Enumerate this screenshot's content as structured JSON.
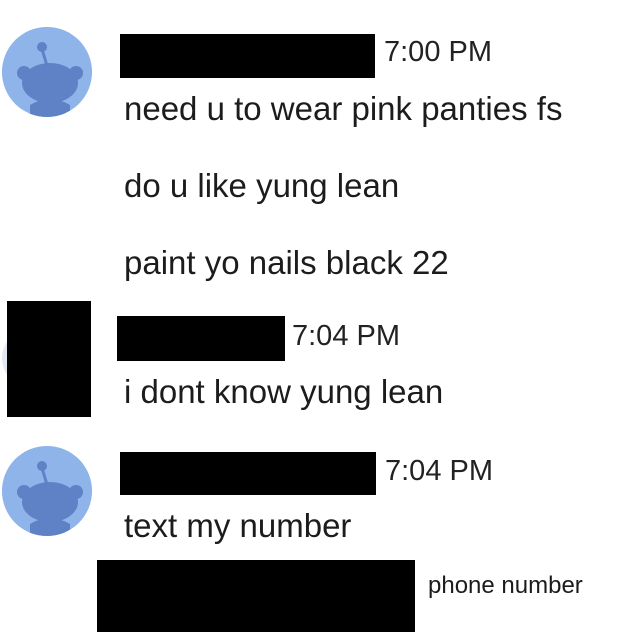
{
  "colors": {
    "avatar_bg": "#8fb4ea",
    "avatar_figure": "#5f81c6",
    "redaction": "#000000",
    "text": "#1c1c1c"
  },
  "groups": [
    {
      "avatar_icon": "reddit-snoo-icon",
      "timestamp": "7:00 PM",
      "messages": [
        "need u to wear pink panties fs",
        "do u like yung lean",
        "paint yo nails black 22"
      ]
    },
    {
      "avatar_icon": "redacted",
      "timestamp": "7:04 PM",
      "messages": [
        "i dont know yung lean"
      ]
    },
    {
      "avatar_icon": "reddit-snoo-icon",
      "timestamp": "7:04 PM",
      "messages": [
        "text my number"
      ]
    }
  ],
  "annotation": "phone number"
}
